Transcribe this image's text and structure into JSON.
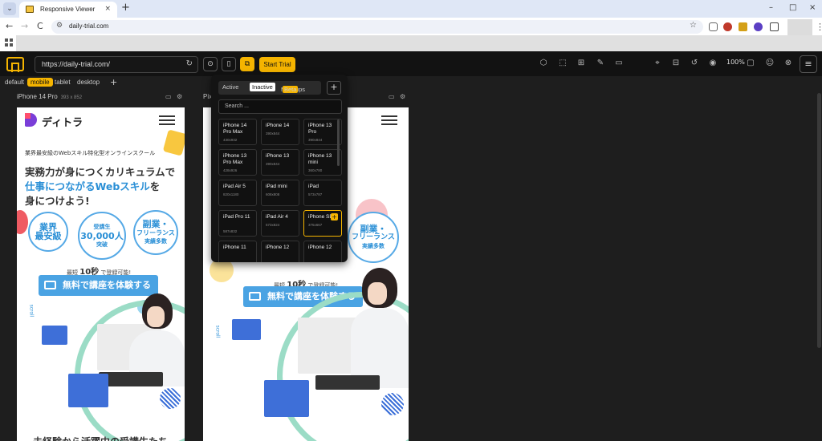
{
  "browser": {
    "tab_title": "Responsive Viewer",
    "tab_menu": "⌄",
    "tab_close": "×",
    "new_tab": "+",
    "url": "daily-trial.com",
    "nav": {
      "back": "←",
      "forward": "→",
      "reload": "C",
      "tune": "⚙",
      "star": "☆"
    },
    "window": {
      "minimize": "–",
      "maximize": "□",
      "close": "×"
    },
    "kebab": "⋮"
  },
  "rv": {
    "url": "https://daily-trial.com/",
    "reload": "↻",
    "start_trial": "Start Trial",
    "zoom": "100%",
    "buttons": {
      "inspect": "⊙",
      "device": "▯",
      "multi": "⧉"
    },
    "tools": [
      "⬡",
      "⬚",
      "⊞",
      "✎",
      "▭",
      "⌖",
      "⊟",
      "↺",
      "◉",
      "▢",
      "☺",
      "⊗"
    ],
    "menu": "≡"
  },
  "device_tabs": {
    "items": [
      "default",
      "mobile",
      "tablet",
      "desktop"
    ],
    "active": "mobile",
    "add": "+"
  },
  "devices": [
    {
      "name": "iPhone 14 Pro",
      "size": "393 x 852"
    },
    {
      "name": "Pix",
      "size": ""
    }
  ],
  "device_icons": {
    "rotate": "▭",
    "settings": "⚙"
  },
  "popup": {
    "tabs": [
      {
        "label": "Active"
      },
      {
        "label": "Inactive",
        "active": true
      },
      {
        "label": "Mockups",
        "badge": "Beta"
      }
    ],
    "add": "+",
    "search_placeholder": "Search ...",
    "device_cards": [
      {
        "name": "iPhone 14 Pro Max",
        "dims": "430x932"
      },
      {
        "name": "iPhone 14",
        "dims": "390x844"
      },
      {
        "name": "iPhone 13 Pro",
        "dims": "390x844"
      },
      {
        "name": "iPhone 13 Pro Max",
        "dims": "428x926"
      },
      {
        "name": "iPhone 13",
        "dims": "390x844"
      },
      {
        "name": "iPhone 13 mini",
        "dims": "360x780"
      },
      {
        "name": "iPad Air 5",
        "dims": "820x1180"
      },
      {
        "name": "iPad mini",
        "dims": "608x808"
      },
      {
        "name": "iPad",
        "dims": "573x787"
      },
      {
        "name": "iPad Pro 11",
        "dims": "587x832"
      },
      {
        "name": "iPad Air 4",
        "dims": "573x824"
      },
      {
        "name": "iPhone SE",
        "dims": "375x667",
        "selected": true,
        "plus": "+"
      },
      {
        "name": "iPhone 11",
        "dims": ""
      },
      {
        "name": "iPhone 12",
        "dims": ""
      },
      {
        "name": "iPhone 12",
        "dims": ""
      }
    ]
  },
  "site": {
    "logo": "ディトラ",
    "sub": "業界最安級のWebスキル特化型オンラインスクール",
    "headline_1": "実務力が身につくカリキュラムで",
    "headline_2a": "仕事につながるWebスキル",
    "headline_2b": "を",
    "headline_3": "身につけよう!",
    "circles": [
      {
        "big": "業界",
        "big2": "最安級"
      },
      {
        "small": "受講生",
        "big": "30,000人",
        "small2": "突破"
      },
      {
        "big": "副業・",
        "big2": "フリーランス",
        "small2": "実績多数"
      }
    ],
    "reg_prefix": "最短",
    "reg_seconds": "10秒",
    "reg_suffix": "で登録可能!",
    "cta": "無料で講座を体験する",
    "scroll": "scroll",
    "bottom_heading": "未経験から活躍中の受講生たち"
  }
}
